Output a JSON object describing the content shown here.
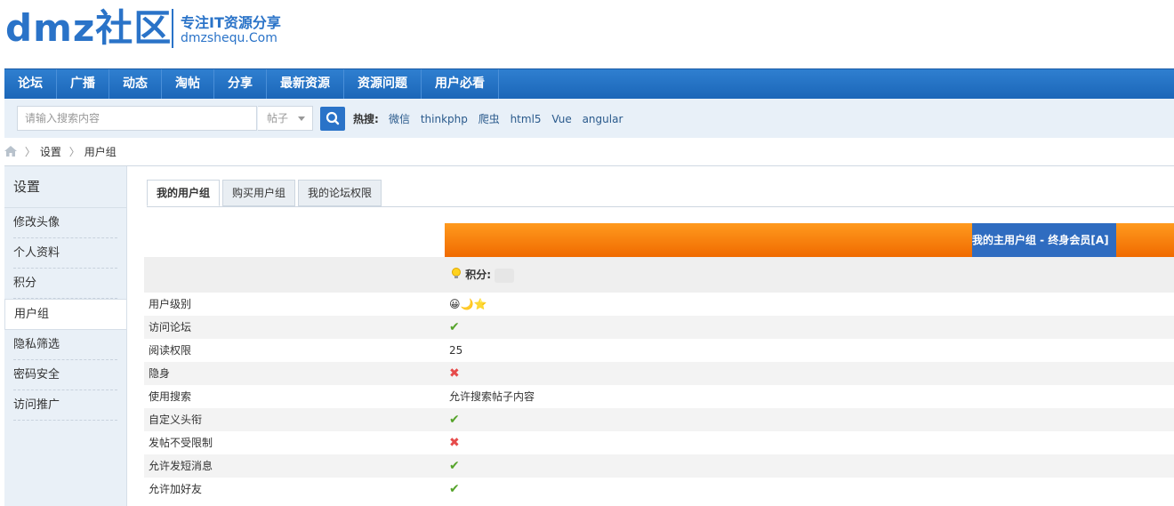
{
  "logo": {
    "title": "dmz社区",
    "slogan1": "专注IT资源分享",
    "slogan2": "dmzshequ.Com"
  },
  "nav": [
    "论坛",
    "广播",
    "动态",
    "淘帖",
    "分享",
    "最新资源",
    "资源问题",
    "用户必看"
  ],
  "search": {
    "placeholder": "请输入搜索内容",
    "type": "帖子",
    "hot_label": "热搜:",
    "hot": [
      "微信",
      "thinkphp",
      "爬虫",
      "html5",
      "Vue",
      "angular"
    ]
  },
  "breadcrumb": [
    "设置",
    "用户组"
  ],
  "sidebar": {
    "title": "设置",
    "items": [
      "修改头像",
      "个人资料",
      "积分",
      "用户组",
      "隐私筛选",
      "密码安全",
      "访问推广"
    ]
  },
  "tabs": [
    "我的用户组",
    "购买用户组",
    "我的论坛权限"
  ],
  "group_header": "我的主用户组 - 终身会员[A]",
  "score_label": "积分:",
  "rows": [
    {
      "label": "用户级别",
      "value": "😀🌙⭐"
    },
    {
      "label": "访问论坛",
      "value": "✔"
    },
    {
      "label": "阅读权限",
      "value": "25"
    },
    {
      "label": "隐身",
      "value": "✖"
    },
    {
      "label": "使用搜索",
      "value": "允许搜索帖子内容"
    },
    {
      "label": "自定义头衔",
      "value": "✔"
    },
    {
      "label": "发帖不受限制",
      "value": "✖"
    },
    {
      "label": "允许发短消息",
      "value": "✔"
    },
    {
      "label": "允许加好友",
      "value": "✔"
    }
  ]
}
